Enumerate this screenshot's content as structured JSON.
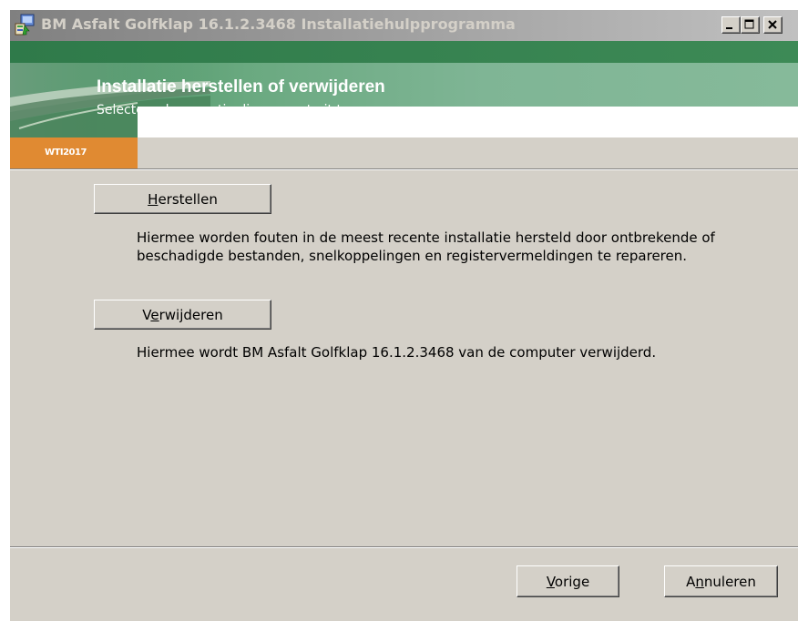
{
  "window": {
    "title": "BM Asfalt Golfklap 16.1.2.3468 Installatiehulpprogramma",
    "controls": {
      "minimize": "minimize",
      "maximize": "maximize",
      "close": "close"
    }
  },
  "banner": {
    "title": "Installatie herstellen of verwijderen",
    "subtitle": "Selecteer de operatie die u wenst uit te voeren.",
    "badge": "WTI2017",
    "colors": {
      "green": "#3c8a58",
      "orange": "#e08a32"
    }
  },
  "options": {
    "repair": {
      "label_pre": "",
      "label_accel": "H",
      "label_post": "erstellen",
      "description": "Hiermee worden fouten in de meest recente installatie hersteld door ontbrekende of beschadigde bestanden, snelkoppelingen en registervermeldingen te repareren."
    },
    "remove": {
      "label_pre": "V",
      "label_accel": "e",
      "label_post": "rwijderen",
      "description": "Hiermee wordt BM Asfalt Golfklap 16.1.2.3468 van de computer verwijderd."
    }
  },
  "footer": {
    "back": {
      "label_pre": "",
      "label_accel": "V",
      "label_post": "orige"
    },
    "cancel": {
      "label_pre": "A",
      "label_accel": "n",
      "label_post": "nuleren"
    }
  }
}
